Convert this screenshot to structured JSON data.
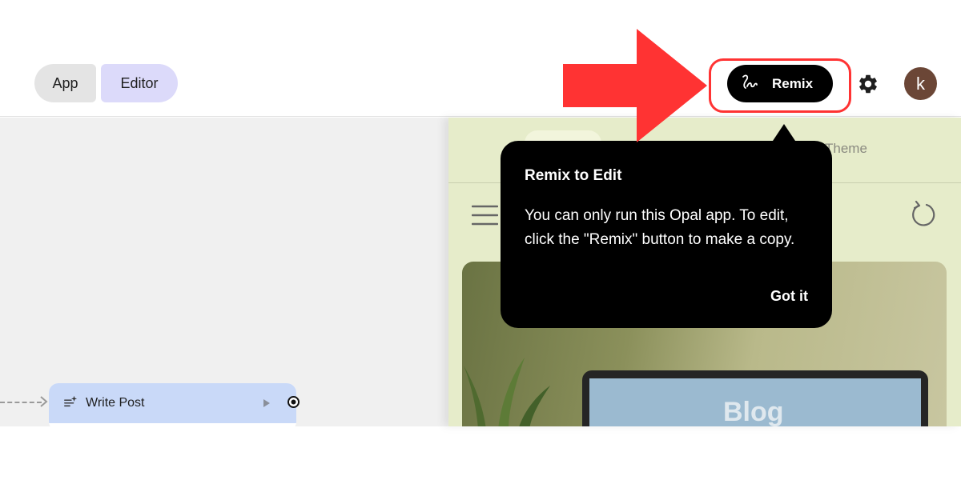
{
  "header": {
    "tabs": [
      {
        "label": "App"
      },
      {
        "label": "Editor"
      }
    ],
    "remix_label": "Remix",
    "avatar_initial": "k"
  },
  "canvas": {
    "node_title": "Write Post"
  },
  "preview": {
    "theme_label": "Theme",
    "hero_text": "Blog"
  },
  "tooltip": {
    "title": "Remix to Edit",
    "body": "You can only run this Opal app. To edit, click the \"Remix\" button to make a copy.",
    "action": "Got it"
  },
  "colors": {
    "annotation_red": "#ff3333",
    "editor_tab": "#dcdafa",
    "node_header": "#c9d9f8",
    "preview_bg": "#e6ecca",
    "avatar": "#6b4636"
  },
  "icons": [
    "remix-icon",
    "gear-icon",
    "hamburger-icon",
    "refresh-icon",
    "node-generate-icon",
    "play-icon",
    "port-icon"
  ]
}
